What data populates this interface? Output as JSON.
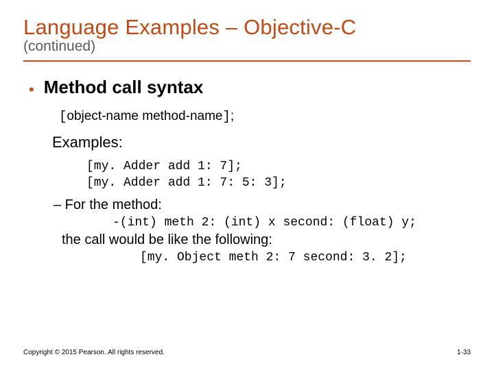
{
  "title": "Language Examples – Objective-C",
  "subtitle": "(continued)",
  "bullet": "Method call syntax",
  "syntax": {
    "open": "[",
    "obj": "object-name",
    "space": " ",
    "meth": "method-name",
    "close": "]",
    "semi": ";"
  },
  "examples_label": "Examples:",
  "example1": "[my. Adder add 1: 7];",
  "example2": "[my. Adder add 1: 7: 5: 3];",
  "for_method": "– For the method:",
  "method_decl": "-(int) meth 2: (int) x second: (float) y;",
  "call_line": "the call would be like the following:",
  "call_code": "[my. Object meth 2: 7 second: 3. 2];",
  "copyright": "Copyright © 2015 Pearson. All rights reserved.",
  "pagenum": "1-33"
}
